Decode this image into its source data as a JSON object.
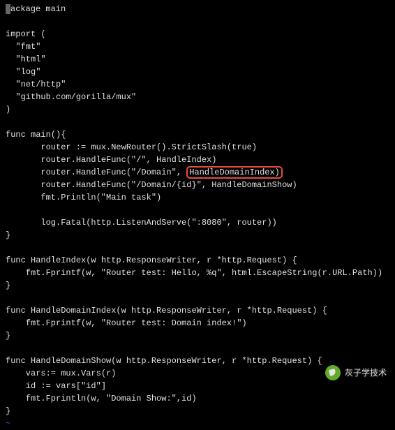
{
  "code": {
    "lines": [
      "package main",
      "",
      "import (",
      "  \"fmt\"",
      "  \"html\"",
      "  \"log\"",
      "  \"net/http\"",
      "  \"github.com/gorilla/mux\"",
      ")",
      "",
      "func main(){",
      "       router := mux.NewRouter().StrictSlash(true)",
      "       router.HandleFunc(\"/\", HandleIndex)",
      "       router.HandleFunc(\"/Domain\", HandleDomainIndex)",
      "       router.HandleFunc(\"/Domain/{id}\", HandleDomainShow)",
      "       fmt.Println(\"Main task\")",
      "",
      "       log.Fatal(http.ListenAndServe(\":8080\", router))",
      "}",
      "",
      "func HandleIndex(w http.ResponseWriter, r *http.Request) {",
      "    fmt.Fprintf(w, \"Router test: Hello, %q\", html.EscapeString(r.URL.Path))",
      "}",
      "",
      "func HandleDomainIndex(w http.ResponseWriter, r *http.Request) {",
      "    fmt.Fprintf(w, \"Router test: Domain index!\")",
      "}",
      "",
      "func HandleDomainShow(w http.ResponseWriter, r *http.Request) {",
      "    vars:= mux.Vars(r)",
      "    id := vars[\"id\"]",
      "    fmt.Fprintln(w, \"Domain Show:\",id)",
      "}"
    ],
    "highlight_line_index": 13,
    "highlight_prefix": "       router.HandleFunc(\"/Domain\", ",
    "highlight_text": "HandleDomainIndex)",
    "tilde": "~"
  },
  "watermark": {
    "label": "灰子学技术"
  }
}
